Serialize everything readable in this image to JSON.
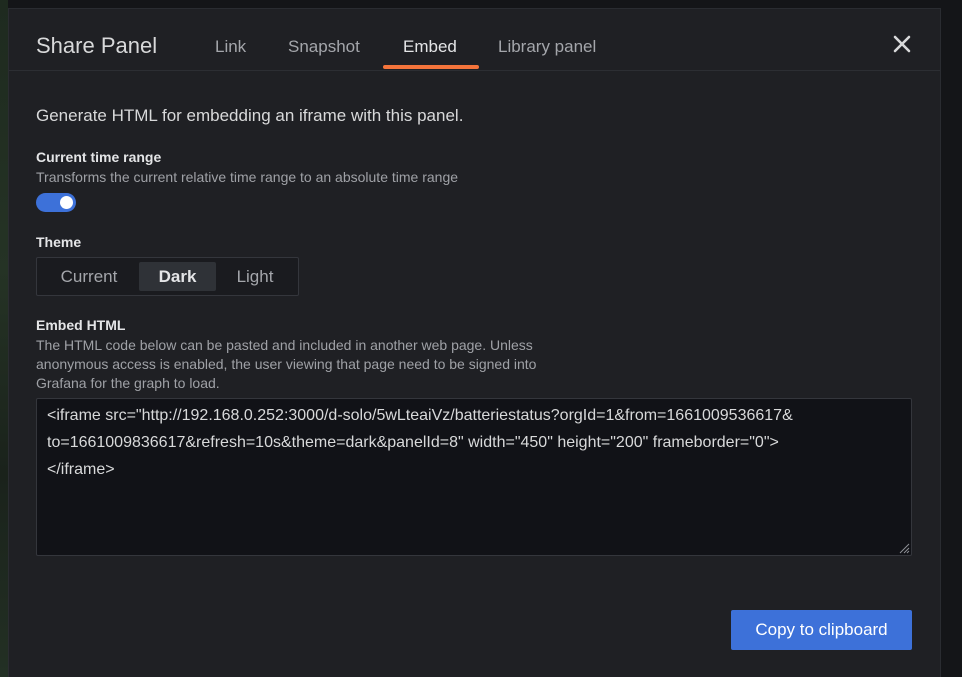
{
  "modal": {
    "title": "Share Panel",
    "tabs": [
      {
        "label": "Link"
      },
      {
        "label": "Snapshot"
      },
      {
        "label": "Embed",
        "active": true
      },
      {
        "label": "Library panel"
      }
    ]
  },
  "embed": {
    "intro": "Generate HTML for embedding an iframe with this panel.",
    "time_range": {
      "label": "Current time range",
      "description": "Transforms the current relative time range to an absolute time range",
      "enabled": true
    },
    "theme": {
      "label": "Theme",
      "options": [
        "Current",
        "Dark",
        "Light"
      ],
      "selected": "Dark"
    },
    "embed_html": {
      "label": "Embed HTML",
      "description_lines": [
        "The HTML code below can be pasted and included in another web page. Unless",
        "anonymous access is enabled, the user viewing that page need to be signed into",
        "Grafana for the graph to load."
      ],
      "code": "<iframe src=\"http://192.168.0.252:3000/d-solo/5wLteaiVz/batteriestatus?orgId=1&from=1661009536617&\nto=1661009836617&refresh=10s&theme=dark&panelId=8\" width=\"450\" height=\"200\" frameborder=\"0\">\n</iframe>"
    },
    "copy_label": "Copy to clipboard"
  },
  "colors": {
    "accent": "#3d71d9",
    "tab_underline": "#f5743b",
    "background": "#1f2024"
  }
}
